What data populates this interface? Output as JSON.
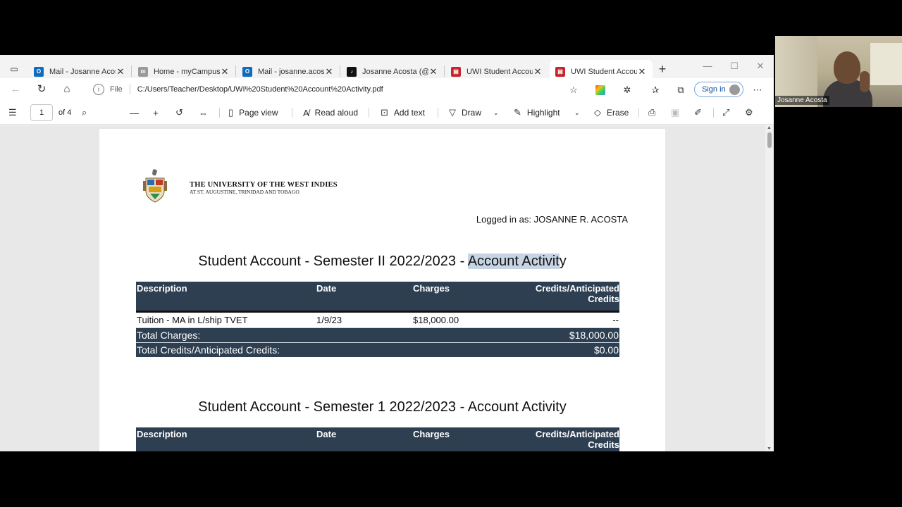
{
  "tabs": [
    {
      "title": "Mail - Josanne Acosta",
      "favicon": "outlook-icon",
      "color": "#0f6cbd"
    },
    {
      "title": "Home - myCampusNet",
      "favicon": "mycampus-icon",
      "color": "#9a9a9a"
    },
    {
      "title": "Mail - josanne.acosta",
      "favicon": "outlook-icon",
      "color": "#0f6cbd"
    },
    {
      "title": "Josanne Acosta (@jos",
      "favicon": "tiktok-icon",
      "color": "#111111"
    },
    {
      "title": "UWI Student Account",
      "favicon": "pdf-icon",
      "color": "#c4262e"
    },
    {
      "title": "UWI Student Account",
      "favicon": "pdf-icon",
      "color": "#c4262e",
      "active": true
    }
  ],
  "address": {
    "scheme_label": "File",
    "url": "C:/Users/Teacher/Desktop/UWI%20Student%20Account%20Activity.pdf"
  },
  "signin_label": "Sign in",
  "pdf_toolbar": {
    "page_current": "1",
    "page_total": "of 4",
    "page_view": "Page view",
    "read_aloud": "Read aloud",
    "add_text": "Add text",
    "draw": "Draw",
    "highlight": "Highlight",
    "erase": "Erase"
  },
  "document": {
    "university_name": "THE UNIVERSITY OF THE WEST INDIES",
    "university_sub": "AT ST. AUGUSTINE, TRINIDAD AND TOBAGO",
    "logged_in": "Logged in as: JOSANNE R. ACOSTA",
    "section1": {
      "title_prefix": "Student Account - Semester II 2022/2023 - ",
      "title_highlight": "Account Activit",
      "title_suffix": "y",
      "headers": [
        "Description",
        "Date",
        "Charges",
        "Credits/Anticipated Credits"
      ],
      "rows": [
        {
          "description": "Tuition - MA in L/ship TVET",
          "date": "1/9/23",
          "charges": "$18,000.00",
          "credits": "--"
        }
      ],
      "total_charges_label": "Total Charges:",
      "total_charges_value": "$18,000.00",
      "total_credits_label": "Total Credits/Anticipated Credits:",
      "total_credits_value": "$0.00"
    },
    "section2": {
      "title": "Student Account - Semester 1 2022/2023 - Account Activity",
      "headers": [
        "Description",
        "Date",
        "Charges",
        "Credits/Anticipated Credits"
      ]
    }
  },
  "webcam": {
    "participant_name": "Josanne Acosta"
  },
  "colors": {
    "table_header": "#2e3f52",
    "highlight": "#c6d4e4",
    "accent": "#0f6cbd"
  }
}
